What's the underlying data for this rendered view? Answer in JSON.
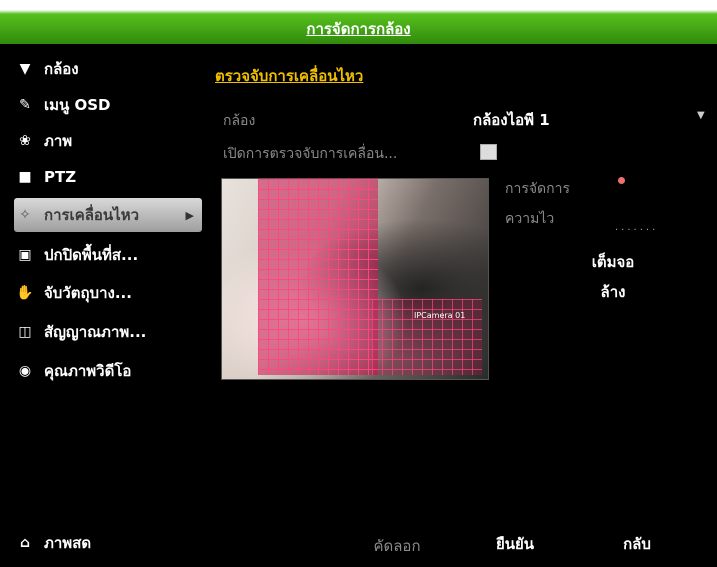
{
  "title": "การจัดการกล้อง",
  "sidebar": {
    "items": [
      {
        "label": "กล้อง",
        "icon": "camera-icon"
      },
      {
        "label": "เมนู OSD",
        "icon": "osd-icon"
      },
      {
        "label": "ภาพ",
        "icon": "image-icon"
      },
      {
        "label": "PTZ",
        "icon": "ptz-icon"
      },
      {
        "label": "การเคลื่อนไหว",
        "icon": "motion-icon",
        "active": true
      },
      {
        "label": "ปกปิดพื้นที่ส...",
        "icon": "privacy-mask-icon"
      },
      {
        "label": "จับวัตถุบาง...",
        "icon": "tamper-icon"
      },
      {
        "label": "สัญญาณภาพ...",
        "icon": "video-loss-icon"
      },
      {
        "label": "คุณภาพวิดีโอ",
        "icon": "video-quality-icon"
      }
    ],
    "live_view": "ภาพสด"
  },
  "main": {
    "section_title": "ตรวจจับการเคลื่อนไหว",
    "camera_label": "กล้อง",
    "camera_value": "กล้องไอพี 1",
    "enable_label": "เปิดการตรวจจับการเคลื่อน...",
    "enable_checked": true,
    "settings_label": "การจัดการ",
    "sensitivity_label": "ความไว",
    "osd_text": "IPCamera 01",
    "full_screen_label": "เต็มจอ",
    "clear_label": "ล้าง"
  },
  "footer": {
    "copy_label": "คัดลอก",
    "apply_label": "ยืนยัน",
    "back_label": "กลับ"
  }
}
